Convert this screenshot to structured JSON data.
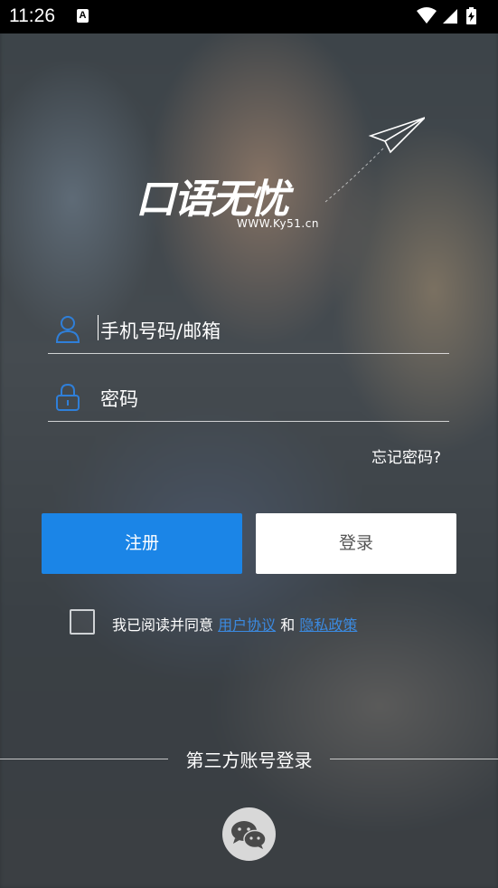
{
  "status_bar": {
    "time": "11:26",
    "notification_icon": "A",
    "icons": [
      "wifi-icon",
      "cellular-icon",
      "battery-charging-icon"
    ]
  },
  "logo": {
    "brand": "口语无忧",
    "url": "WWW.Ky51.cn"
  },
  "form": {
    "account_placeholder": "手机号码/邮箱",
    "password_placeholder": "密码",
    "forgot_password": "忘记密码?"
  },
  "buttons": {
    "register": "注册",
    "login": "登录"
  },
  "agreement": {
    "prefix": "我已阅读并同意",
    "user_agreement": "用户协议",
    "and": "和",
    "privacy_policy": "隐私政策",
    "checked": false
  },
  "third_party": {
    "title": "第三方账号登录",
    "providers": [
      "wechat-icon"
    ]
  },
  "colors": {
    "primary": "#1b85e7",
    "link": "#3b8ae0",
    "icon_blue": "#2f7fd9"
  }
}
